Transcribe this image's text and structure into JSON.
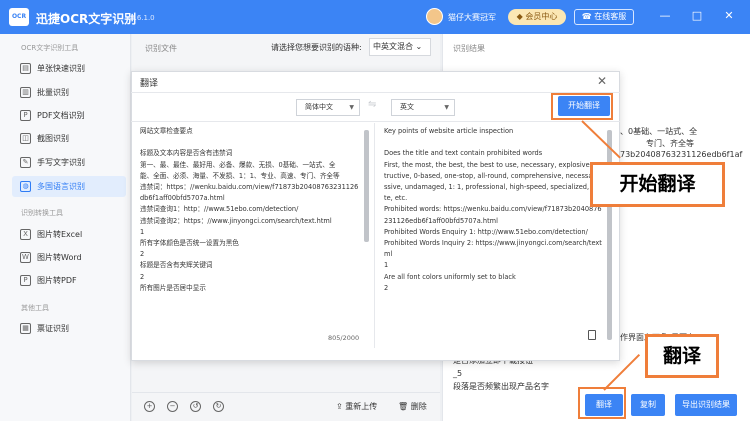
{
  "app": {
    "title": "迅捷OCR文字识别",
    "version": "v8.6.1.0",
    "username": "猫仔大赛冠军",
    "vip_label": "会员中心",
    "service_label": "在线客服",
    "window_controls": [
      "minimize-icon",
      "maximize-icon",
      "close-icon"
    ]
  },
  "sidebar": {
    "sections": [
      {
        "label": "OCR文字识别工具",
        "items": [
          {
            "icon": "document-scan-icon",
            "label": "单张快速识别"
          },
          {
            "icon": "stack-icon",
            "label": "批量识别"
          },
          {
            "icon": "pdf-icon",
            "label": "PDF文档识别"
          },
          {
            "icon": "screenshot-icon",
            "label": "截图识别"
          },
          {
            "icon": "pen-icon",
            "label": "手写文字识别"
          },
          {
            "icon": "globe-icon",
            "label": "多国语言识别",
            "active": true
          }
        ]
      },
      {
        "label": "识别转换工具",
        "items": [
          {
            "icon": "excel-icon",
            "label": "图片转Excel"
          },
          {
            "icon": "word-icon",
            "label": "图片转Word"
          },
          {
            "icon": "pdf-icon",
            "label": "图片转PDF"
          }
        ]
      },
      {
        "label": "其他工具",
        "items": [
          {
            "icon": "receipt-icon",
            "label": "票证识别"
          }
        ]
      }
    ]
  },
  "main": {
    "header": "识别文件",
    "lang_prompt": "请选择您想要识别的语种:",
    "lang_value": "中英文混合",
    "bottom": {
      "reupload": "重新上传",
      "delete": "删除"
    }
  },
  "result": {
    "header": "识别结果",
    "bg_lines": [
      "、0基础、一站式、全",
      "专门、齐全等",
      "73b20408763231126edb6f1af",
      "作界面左下角)是否有",
      "是否添加立即下载按钮",
      "_5",
      "段落是否频繁出现产品名字"
    ],
    "translate_btn": "翻译",
    "copy_btn": "复制",
    "export_btn": "导出识别结果"
  },
  "dialog": {
    "title": "翻译",
    "source_lang": "简体中文",
    "target_lang": "英文",
    "start_btn": "开始翻译",
    "char_count": "805/2000",
    "source_lines": [
      "网站文章检查要点",
      "",
      "标题及文本内容是否含有违禁词",
      "第一、最、最佳、最好用、必备、爆款、无损、0基础、一站式、全",
      "能、全面、必须、海量、不发损、1：1、专业、高速、专门、齐全等",
      "违禁词：https：//wenku.baidu.com/view/f71873b20408763231126e",
      "db6f1aff00bfd5707a.html",
      "违禁词查询1：http：//www.51ebo.com/detection/",
      "违禁词查询2：https：//www.jinyongci.com/search/text.html",
      "1",
      "所有字体颜色是否统一设置为黑色",
      "2",
      "标题是否含有夹辉关键词",
      "2",
      "所有图片是否居中显示"
    ],
    "target_lines": [
      "Key points of website article inspection",
      "",
      "Does the title and text contain prohibited words",
      "First, the most, the best, the best to use, necessary, explosive, nondes",
      "tructive, 0-based, one-stop, all-round, comprehensive, necessary, ma",
      "ssive, undamaged, 1: 1, professional, high-speed, specialized, comple",
      "te, etc.",
      "Prohibited words: https://wenku.baidu.com/view/f71873b20408763",
      "231126edb6f1aff00bfd5707a.html",
      "Prohibited Words Enquiry 1: http://www.51ebo.com/detection/",
      "Prohibited Words Inquiry 2: https://www.jinyongci.com/search/text.ht",
      "ml",
      "1",
      "Are all font colors uniformly set to black",
      "2"
    ]
  },
  "annotations": {
    "callout_start": "开始翻译",
    "callout_translate": "翻译",
    "color": "#ef7e3a"
  }
}
